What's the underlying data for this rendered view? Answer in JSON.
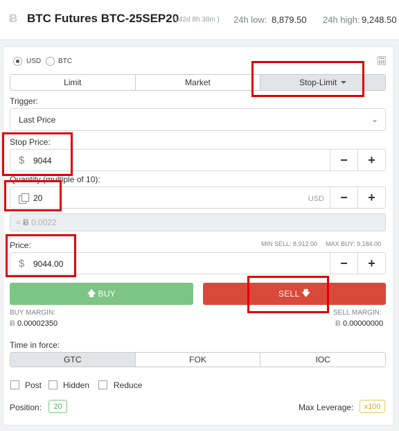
{
  "header": {
    "title": "BTC Futures BTC-25SEP20",
    "expiry": "(142d 8h 38m )",
    "low_label": "24h low:",
    "low_value": "8,879.50",
    "high_label": "24h high:",
    "high_value": "9,248.50"
  },
  "currency": {
    "usd": "USD",
    "btc": "BTC",
    "selected": "USD"
  },
  "order_types": [
    "Limit",
    "Market",
    "Stop-Limit"
  ],
  "order_type_selected": "Stop-Limit",
  "trigger": {
    "label": "Trigger:",
    "value": "Last Price"
  },
  "stop_price": {
    "label": "Stop Price:",
    "symbol": "$",
    "value": "9044",
    "minus": "−",
    "plus": "+"
  },
  "quantity": {
    "label": "Quantity (multiple of 10):",
    "value": "20",
    "unit": "USD",
    "minus": "−",
    "plus": "+"
  },
  "btc_equiv": {
    "prefix": "≈",
    "symbol": "Ƀ",
    "value": "0.0022"
  },
  "price": {
    "label": "Price:",
    "min_sell": "MIN SELL: 8,912.00",
    "max_buy": "MAX BUY: 9,184.00",
    "symbol": "$",
    "value": "9044.00",
    "minus": "−",
    "plus": "+"
  },
  "buy": {
    "label": "BUY",
    "margin_label": "BUY MARGIN:",
    "margin_value": "0.00002350",
    "color": "#7cc584"
  },
  "sell": {
    "label": "SELL",
    "margin_label": "SELL MARGIN:",
    "margin_value": "0.00000000",
    "color": "#d9493a"
  },
  "time_in_force": {
    "label": "Time in force:",
    "options": [
      "GTC",
      "FOK",
      "IOC"
    ],
    "selected": "GTC"
  },
  "flags": [
    "Post",
    "Hidden",
    "Reduce"
  ],
  "position": {
    "label": "Position:",
    "value": "20"
  },
  "leverage": {
    "label": "Max Leverage:",
    "value": "x100"
  },
  "icons": {
    "logo": "bitcoin-logo-icon",
    "calculator": "calculator-icon",
    "copy": "copy-icon"
  }
}
